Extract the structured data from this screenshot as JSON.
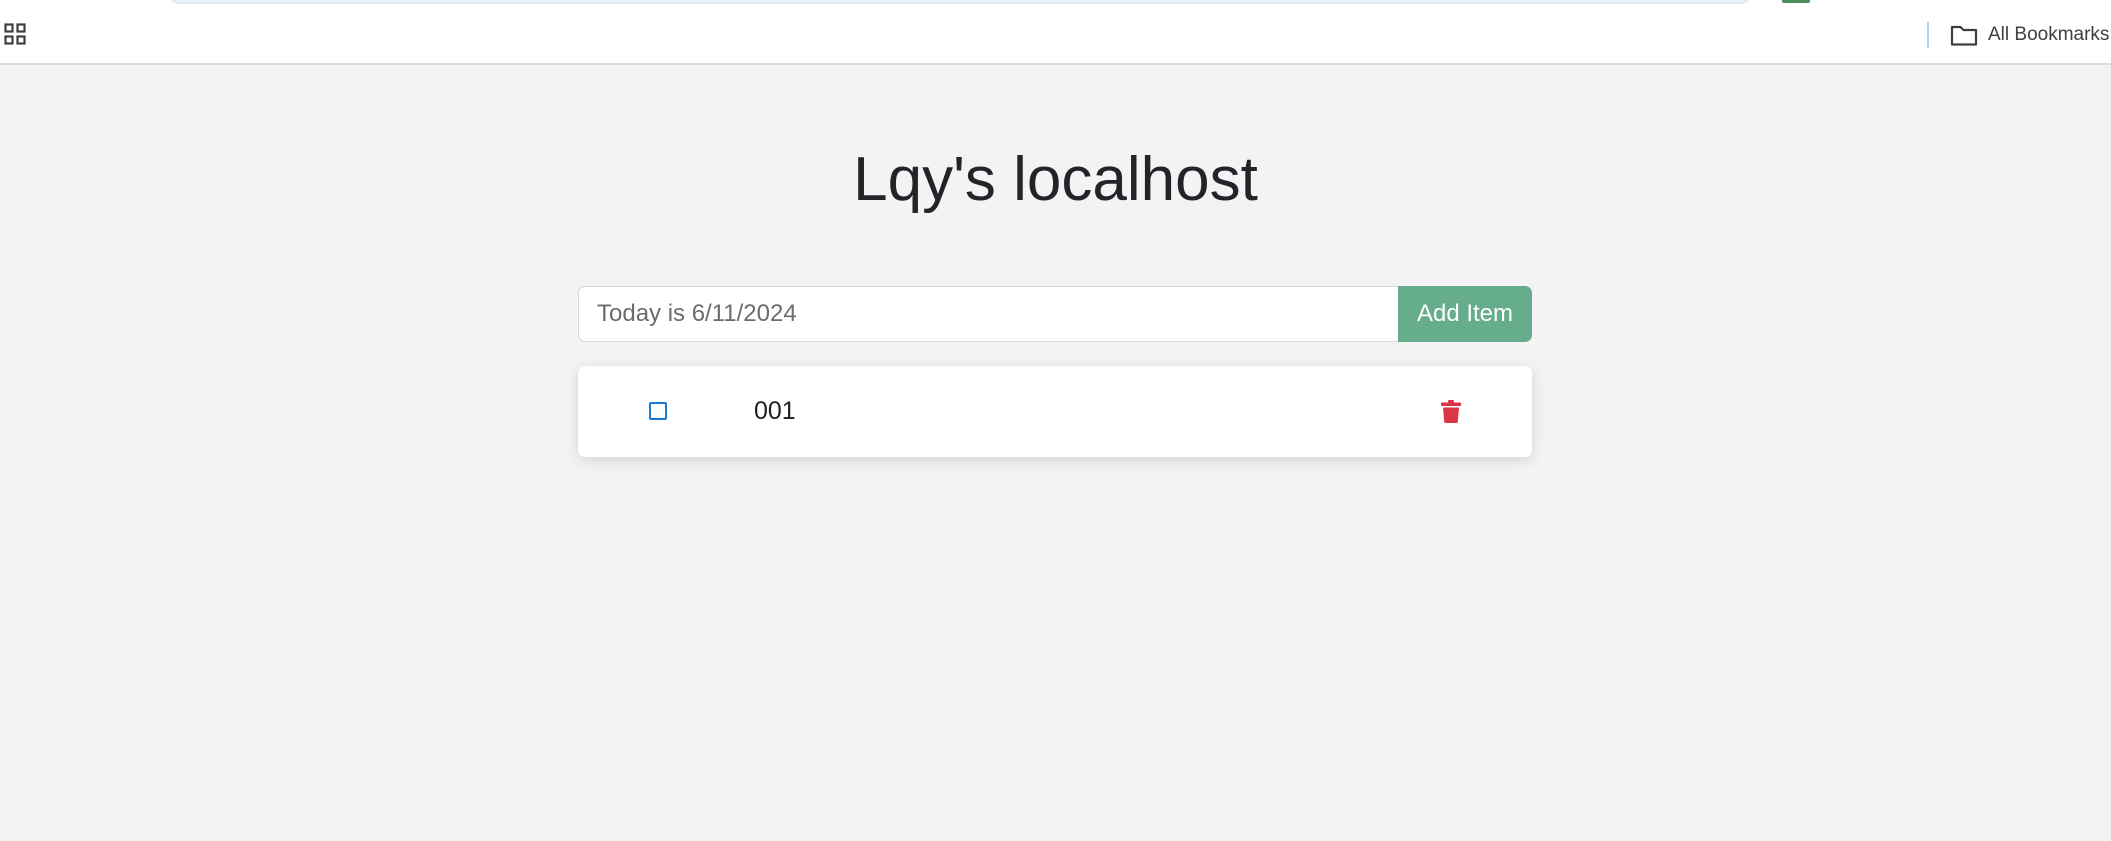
{
  "browser": {
    "bookmarks_bar": {
      "apps_icon": "apps-grid-icon",
      "all_bookmarks_label": "All Bookmarks",
      "all_bookmarks_icon": "folder-icon"
    }
  },
  "page": {
    "title": "Lqy's localhost"
  },
  "add_form": {
    "input_placeholder": "Today is 6/11/2024",
    "input_value": "",
    "add_button_label": "Add Item"
  },
  "todos": [
    {
      "text": "001",
      "checked": false,
      "checkbox_icon": "empty-square-icon",
      "delete_icon": "trash-icon"
    }
  ],
  "colors": {
    "page_background": "#f3f3f3",
    "add_button": "#65ad8b",
    "checkbox": "#1a78d2",
    "delete_icon": "#dc3545",
    "title_text": "#212529"
  }
}
